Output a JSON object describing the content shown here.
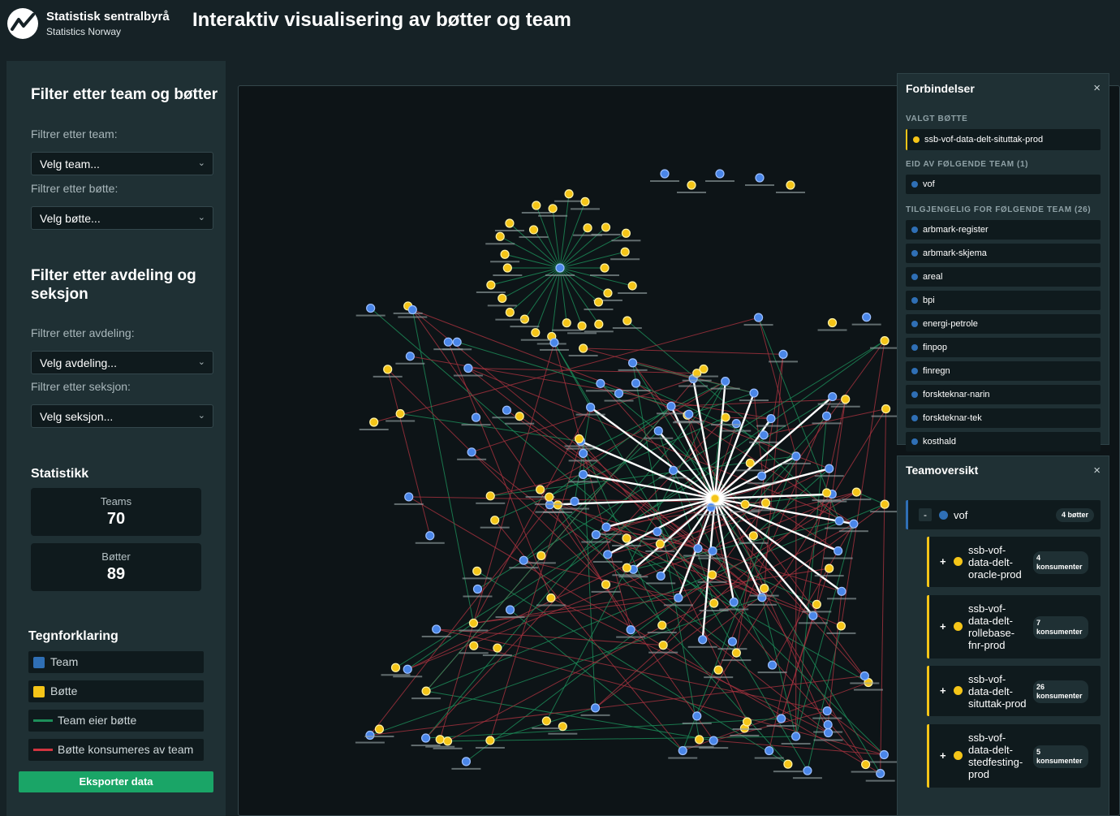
{
  "header": {
    "brand_name": "Statistisk sentralbyrå",
    "brand_sub": "Statistics Norway",
    "title": "Interaktiv visualisering av bøtter og team"
  },
  "sidebar": {
    "filter_team_heading": "Filter etter team og bøtter",
    "team_label": "Filtrer etter team:",
    "team_select": "Velg team...",
    "bucket_label": "Filtrer etter bøtte:",
    "bucket_select": "Velg bøtte...",
    "filter_dept_heading": "Filter etter avdeling og seksjon",
    "dept_label": "Filtrer etter avdeling:",
    "dept_select": "Velg avdeling...",
    "section_label": "Filtrer etter seksjon:",
    "section_select": "Velg seksjon...",
    "stats_heading": "Statistikk",
    "stats": {
      "teams_label": "Teams",
      "teams_value": "70",
      "buckets_label": "Bøtter",
      "buckets_value": "89"
    },
    "legend_heading": "Tegnforklaring",
    "legend": {
      "team": "Team",
      "bucket": "Bøtte",
      "owns": "Team eier bøtte",
      "consumes": "Bøtte konsumeres av team"
    },
    "export_label": "Eksporter data"
  },
  "colors": {
    "team": "#3a7bd5",
    "bucket": "#f5c518",
    "owner_edge": "#1d8f5a",
    "consumer_edge": "#b8323f",
    "accent": "#1aa567"
  },
  "connections": {
    "title": "Forbindelser",
    "close": "×",
    "selected_heading": "VALGT BØTTE",
    "selected_bucket": "ssb-vof-data-delt-situttak-prod",
    "owned_heading": "EID AV FØLGENDE TEAM (1)",
    "owners": [
      "vof"
    ],
    "available_heading": "TILGJENGELIG FOR FØLGENDE TEAM (26)",
    "available": [
      "arbmark-register",
      "arbmark-skjema",
      "areal",
      "bpi",
      "energi-petrole",
      "finpop",
      "finregn",
      "forskteknar-narin",
      "forskteknar-tek",
      "kosthald"
    ]
  },
  "team_overview": {
    "title": "Teamoversikt",
    "close": "×",
    "team": {
      "toggle": "-",
      "name": "vof",
      "count": "4 bøtter"
    },
    "buckets": [
      {
        "toggle": "+",
        "name": "ssb-vof-data-delt-oracle-prod",
        "count": "4",
        "count_label": "konsumenter"
      },
      {
        "toggle": "+",
        "name": "ssb-vof-data-delt-rollebase-fnr-prod",
        "count": "7",
        "count_label": "konsumenter"
      },
      {
        "toggle": "+",
        "name": "ssb-vof-data-delt-situttak-prod",
        "count": "26",
        "count_label": "konsumenter"
      },
      {
        "toggle": "+",
        "name": "ssb-vof-data-delt-stedfesting-prod",
        "count": "5",
        "count_label": "konsumenter"
      }
    ]
  }
}
